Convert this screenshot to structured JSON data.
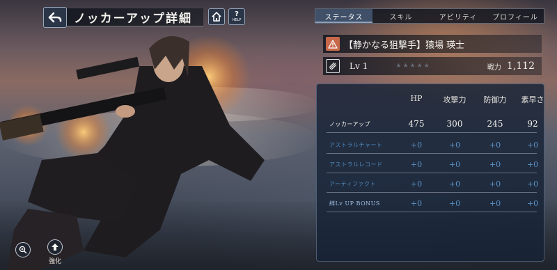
{
  "header": {
    "title": "ノッカーアップ詳細",
    "help_label": "HELP",
    "help_glyph": "?"
  },
  "tabs": [
    {
      "label": "ステータス",
      "active": true
    },
    {
      "label": "スキル",
      "active": false
    },
    {
      "label": "アビリティ",
      "active": false
    },
    {
      "label": "プロフィール",
      "active": false
    }
  ],
  "character": {
    "name": "【静かなる狙撃手】猿場 瑛士",
    "level_label": "Lv",
    "level": "1",
    "stars": "★★★★★",
    "power_label": "戦力",
    "power": "1,112"
  },
  "stats": {
    "headers": [
      "HP",
      "攻撃力",
      "防御力",
      "素早さ"
    ],
    "rows": [
      {
        "label": "ノッカーアップ",
        "values": [
          "475",
          "300",
          "245",
          "92"
        ]
      },
      {
        "label": "アストラルチャート",
        "values": [
          "+0",
          "+0",
          "+0",
          "+0"
        ]
      },
      {
        "label": "アストラルレコード",
        "values": [
          "+0",
          "+0",
          "+0",
          "+0"
        ]
      },
      {
        "label": "アーティファクト",
        "values": [
          "+0",
          "+0",
          "+0",
          "+0"
        ]
      },
      {
        "label": "絆Lv UP BONUS",
        "values": [
          "+0",
          "+0",
          "+0",
          "+0"
        ]
      }
    ]
  },
  "bottom": {
    "enhance_label": "強化"
  },
  "icons": {
    "back": "back-arrow-icon",
    "home": "home-icon",
    "warning": "warning-icon",
    "class": "sniper-class-icon",
    "zoom": "zoom-icon",
    "enhance": "enhance-arrow-icon"
  },
  "colors": {
    "accent_tab": "#3f5068",
    "warning_badge": "#c8684a",
    "bonus_value": "#5c95c9"
  }
}
